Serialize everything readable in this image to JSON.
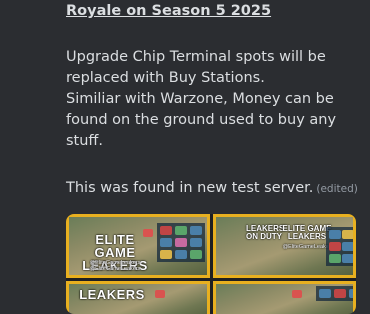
{
  "message": {
    "title": "Royale on Season 5 2025",
    "paragraph1": [
      "Upgrade Chip Terminal spots will be",
      "replaced with Buy Stations.",
      "Similiar with Warzone, Money can be",
      "found on the ground used to buy any",
      "stuff."
    ],
    "paragraph2": "This was found in new test server.",
    "edited_label": "(edited)"
  },
  "attachments": {
    "watermark_main": "ELITE GAME",
    "watermark_main_2": "LEAKERS",
    "watermark_handle": "@EliteGameLeakers",
    "watermark_handle_2": "@EliteGameLeakers",
    "watermark_side": "LEAKERS",
    "watermark_side_2": "ON DUTY",
    "watermark_side_3": "ELITE GAME",
    "watermark_side_4": "LEAKERS",
    "watermark_side_handle": "@EliteGameLeakers",
    "watermark_bottom": "LEAKERS",
    "accent_border": "#e8b020"
  }
}
